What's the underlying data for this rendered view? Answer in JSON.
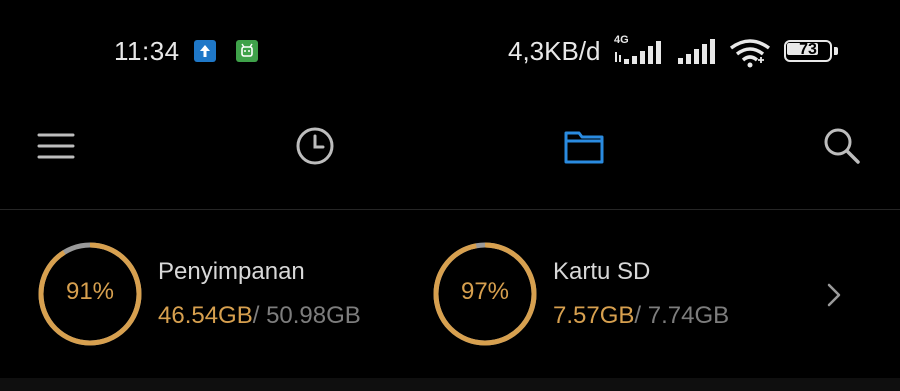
{
  "status_bar": {
    "time": "11:34",
    "net_speed": "4,3KB/d",
    "network_type": "4G",
    "battery_level": "73",
    "battery_fraction": 0.73
  },
  "toolbar": {
    "icons": [
      "menu-icon",
      "clock-icon",
      "folder-icon",
      "search-icon"
    ],
    "active_color": "#2a8be0",
    "icon_color": "#bdbdbd"
  },
  "storage": [
    {
      "name": "Penyimpanan",
      "percent_label": "91%",
      "percent": 0.91,
      "used": "46.54GB",
      "total": "/ 50.98GB"
    },
    {
      "name": "Kartu SD",
      "percent_label": "97%",
      "percent": 0.97,
      "used": "7.57GB",
      "total": "/ 7.74GB"
    }
  ],
  "colors": {
    "accent": "#d7a04f",
    "ring_track": "#9a9a9a",
    "background": "#000000"
  }
}
